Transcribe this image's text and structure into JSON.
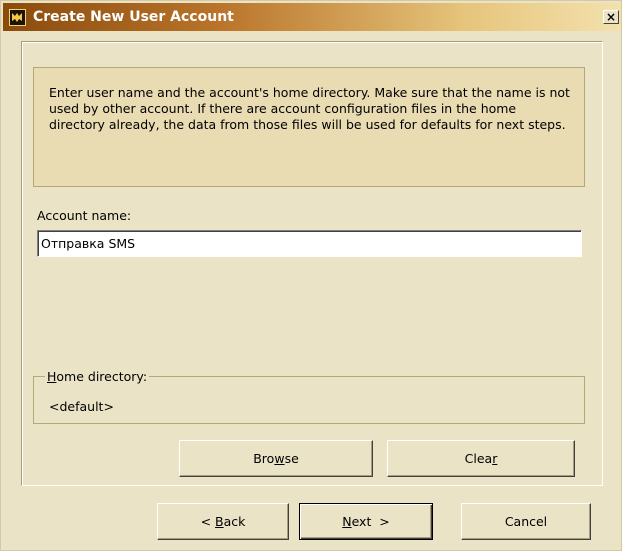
{
  "window": {
    "title": "Create New User Account",
    "close_label": "×"
  },
  "info": {
    "text": "Enter user name and the account's home directory. Make sure that the name is not used by other account. If there are account configuration files in the home directory already, the data from those files will be used for defaults for next steps."
  },
  "account": {
    "label": "Account name:",
    "value": "Отправка SMS"
  },
  "home": {
    "label_accel": "H",
    "label_rest": "ome directory:",
    "value": "<default>"
  },
  "buttons": {
    "browse_pre": "Bro",
    "browse_accel": "w",
    "browse_post": "se",
    "clear_pre": "Clea",
    "clear_accel": "r",
    "clear_post": "",
    "back_pre": "< ",
    "back_accel": "B",
    "back_post": "ack",
    "next_pre": "",
    "next_accel": "N",
    "next_post": "ext  >",
    "cancel": "Cancel"
  },
  "colors": {
    "face": "#ebe3c6",
    "title_start": "#8a4b0d",
    "title_end": "#f3e1ad"
  }
}
